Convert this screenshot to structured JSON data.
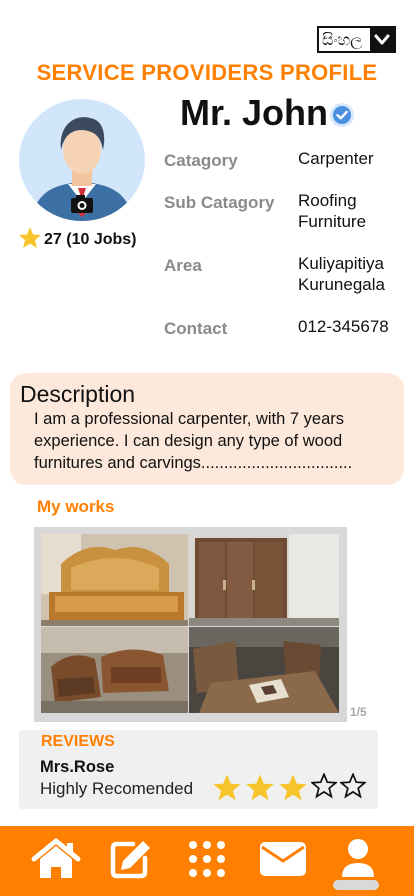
{
  "language_select": {
    "value": "සිංහල"
  },
  "page_title": "SERVICE PROVIDERS PROFILE",
  "provider": {
    "name": "Mr. John",
    "rating": "27 (10 Jobs)"
  },
  "info": [
    {
      "label": "Catagory",
      "value": "Carpenter"
    },
    {
      "label": "Sub Catagory",
      "value": "Roofing\nFurniture"
    },
    {
      "label": "Area",
      "value": "Kuliyapitiya\nKurunegala"
    },
    {
      "label": "Contact",
      "value": "012-345678"
    }
  ],
  "description": {
    "title": "Description",
    "text": "I am a professional carpenter, with 7 years experience. I can design any type of wood furnitures and carvings................................."
  },
  "works": {
    "title": "My works",
    "counter": "1/5"
  },
  "reviews": {
    "title": "REVIEWS",
    "reviewer": "Mrs.Rose",
    "text": "Highly Recomended",
    "rating": 3,
    "max_rating": 5
  },
  "nav": {
    "items": [
      "home-icon",
      "edit-icon",
      "grid-icon",
      "mail-icon",
      "profile-icon"
    ],
    "active": "profile-icon"
  },
  "colors": {
    "accent": "#ff8000",
    "description_bg": "#fde9db",
    "star": "#f7c52b",
    "verified": "#4a90e2"
  }
}
